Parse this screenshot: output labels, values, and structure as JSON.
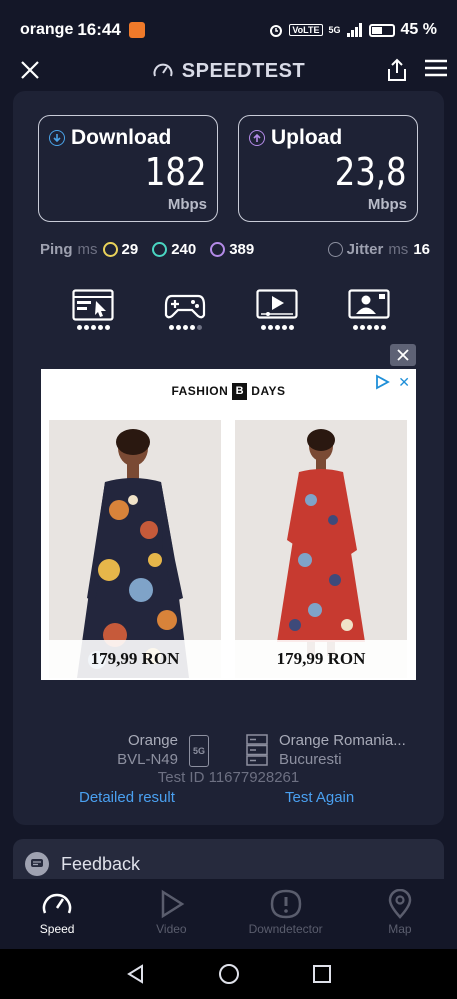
{
  "status_bar": {
    "carrier": "orange",
    "time": "16:44",
    "network": "5G",
    "volte": "VoLTE",
    "battery": "45 %"
  },
  "header": {
    "title": "SPEEDTEST"
  },
  "results": {
    "download": {
      "label": "Download",
      "value": "182",
      "unit": "Mbps"
    },
    "upload": {
      "label": "Upload",
      "value": "23,8",
      "unit": "Mbps"
    }
  },
  "ping": {
    "label": "Ping",
    "unit": "ms",
    "idle": "29",
    "download": "240",
    "upload": "389",
    "jitter_label": "Jitter",
    "jitter_unit": "ms",
    "jitter_value": "16"
  },
  "categories": [
    {
      "icon": "web-browsing-icon",
      "rating": 5
    },
    {
      "icon": "gaming-icon",
      "rating": 4
    },
    {
      "icon": "video-streaming-icon",
      "rating": 5
    },
    {
      "icon": "video-call-icon",
      "rating": 5
    }
  ],
  "ad": {
    "brand_left": "FASHION",
    "brand_box": "B",
    "brand_right": "DAYS",
    "products": [
      {
        "price": "179,99 RON"
      },
      {
        "price": "179,99 RON"
      }
    ]
  },
  "connection": {
    "isp": "Orange",
    "device": "BVL-N49",
    "network_badge": "5G",
    "server_name": "Orange Romania...",
    "server_location": "Bucuresti",
    "test_id": "Test ID 11677928261",
    "detailed_result": "Detailed result",
    "test_again": "Test Again"
  },
  "feedback": {
    "label": "Feedback"
  },
  "bottom_nav": [
    {
      "label": "Speed",
      "active": true
    },
    {
      "label": "Video",
      "active": false
    },
    {
      "label": "Downdetector",
      "active": false
    },
    {
      "label": "Map",
      "active": false
    }
  ],
  "colors": {
    "background": "#141728",
    "card": "#1e2235",
    "download_accent": "#4aa3e8",
    "upload_accent": "#b48be8",
    "ping_idle": "#e9d25a",
    "ping_download": "#4ad6c2",
    "link": "#4aa0f0"
  }
}
